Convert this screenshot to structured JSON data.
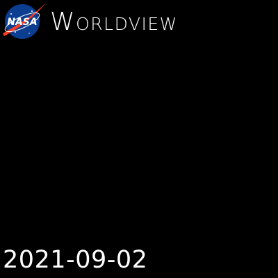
{
  "logo": {
    "text": "NASA",
    "icon": "nasa-meatball-icon",
    "colors": {
      "globe": "#0b3d91",
      "swoosh": "#fc3d21",
      "text": "#ffffff"
    }
  },
  "app": {
    "title_initial": "W",
    "title_rest": "ORLDVIEW"
  },
  "map": {
    "background": "#000000"
  },
  "date": "2021-09-02"
}
